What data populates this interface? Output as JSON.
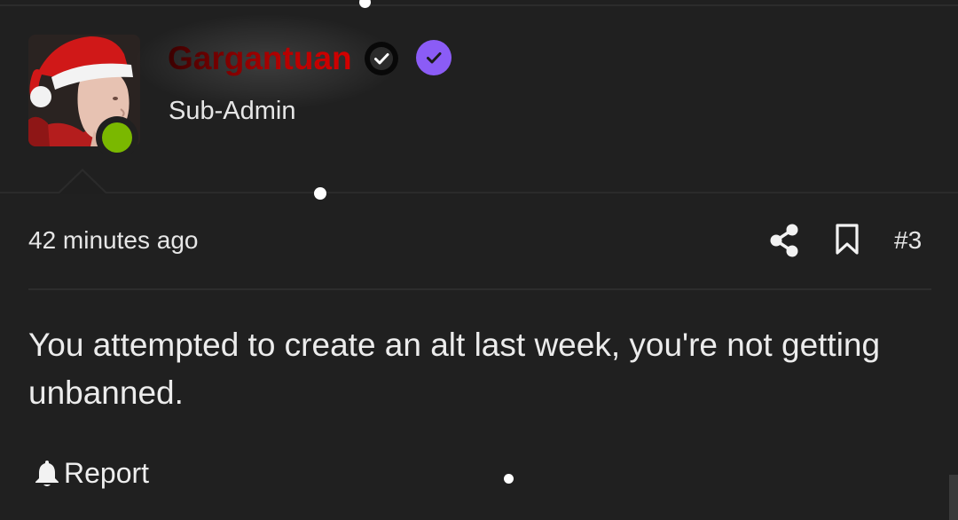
{
  "colors": {
    "background": "#202020",
    "username_gradient_start": "#3a0000",
    "username_gradient_end": "#d40000",
    "online_status": "#7ab800",
    "staff_badge": "#8b5cf6"
  },
  "author": {
    "username": "Gargantuan",
    "user_title": "Sub-Admin",
    "avatar_icon": "avatar-santa-hat",
    "status": "online",
    "badges": [
      "verified-check-icon",
      "staff-check-icon"
    ]
  },
  "post": {
    "time": "42 minutes ago",
    "number": "#3",
    "body": "You attempted to create an alt last week, you're not getting unbanned.",
    "actions": {
      "share_icon": "share-icon",
      "bookmark_icon": "bookmark-icon",
      "report_label": "Report",
      "report_icon": "bell-icon"
    }
  }
}
